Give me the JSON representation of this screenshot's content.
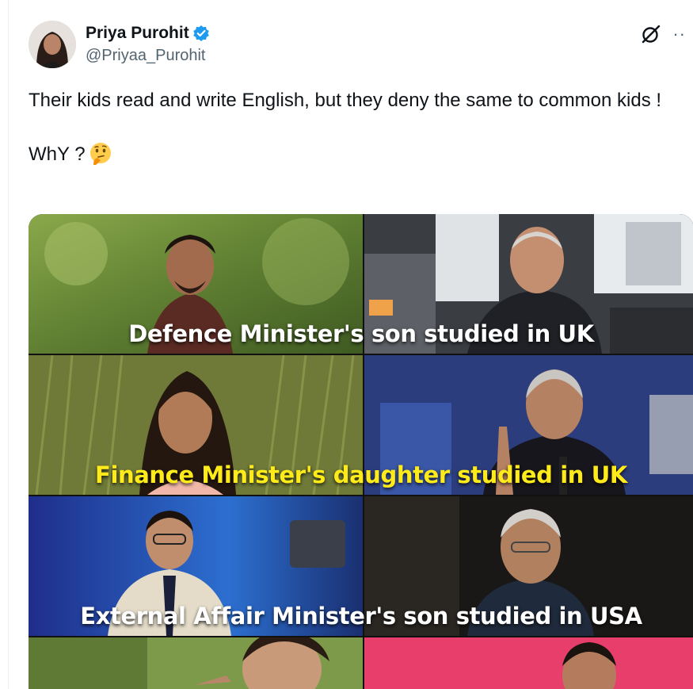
{
  "author": {
    "display_name": "Priya Purohit",
    "handle": "@Priyaa_Purohit",
    "verified": true,
    "avatar_icon": "profile-photo"
  },
  "actions": {
    "grok_icon": "grok-icon",
    "more_icon": "more-options-icon",
    "more_label": "··"
  },
  "tweet": {
    "line1": "Their kids read and write English, but they deny the same to common kids !",
    "line2": "WhY ?",
    "emoji": "thinking-face-emoji"
  },
  "media": {
    "captions": [
      "Defence Minister's son studied in UK",
      "Finance Minister's daughter studied in UK",
      "External Affair Minister's son studied in USA"
    ],
    "caption_colors": [
      "#ffffff",
      "#ffeb1a",
      "#ffffff"
    ]
  },
  "colors": {
    "accent": "#1d9bf0",
    "text": "#0f1419",
    "secondary": "#536471"
  }
}
